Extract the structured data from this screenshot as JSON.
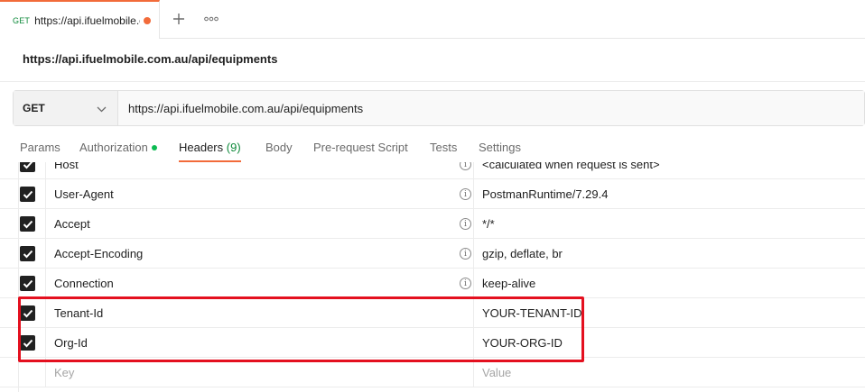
{
  "tab": {
    "method": "GET",
    "title": "https://api.ifuelmobile.c",
    "unsaved_color": "#f26b3a",
    "plus_icon": "plus-icon",
    "more_icon": "more-horizontal-icon"
  },
  "request": {
    "title": "https://api.ifuelmobile.com.au/api/equipments",
    "method": "GET",
    "url": "https://api.ifuelmobile.com.au/api/equipments"
  },
  "request_tabs": {
    "params": "Params",
    "authorization": "Authorization",
    "headers": "Headers",
    "headers_count": "(9)",
    "body": "Body",
    "prerequest": "Pre-request Script",
    "tests": "Tests",
    "settings": "Settings"
  },
  "headers": [
    {
      "key": "Host",
      "value": "<calculated when request is sent>",
      "checked": true,
      "info": true
    },
    {
      "key": "User-Agent",
      "value": "PostmanRuntime/7.29.4",
      "checked": true,
      "info": true
    },
    {
      "key": "Accept",
      "value": "*/*",
      "checked": true,
      "info": true
    },
    {
      "key": "Accept-Encoding",
      "value": "gzip, deflate, br",
      "checked": true,
      "info": true
    },
    {
      "key": "Connection",
      "value": "keep-alive",
      "checked": true,
      "info": true
    },
    {
      "key": "Tenant-Id",
      "value": "YOUR-TENANT-ID",
      "checked": true,
      "info": false
    },
    {
      "key": "Org-Id",
      "value": "YOUR-ORG-ID",
      "checked": true,
      "info": false
    }
  ],
  "new_row": {
    "key_placeholder": "Key",
    "value_placeholder": "Value"
  },
  "info_glyph": "i",
  "colors": {
    "accent": "#f26b3a",
    "success": "#0f8a3b",
    "highlight": "#e4101f"
  }
}
